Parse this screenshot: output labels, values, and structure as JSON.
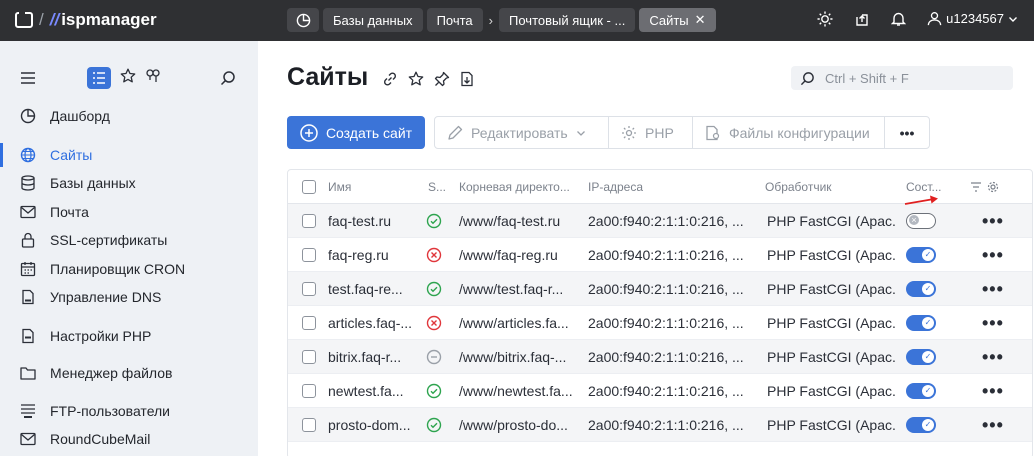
{
  "topbar": {
    "logo_text": "ispmanager",
    "breadcrumbs": [
      "Базы данных",
      "Почта",
      "Почтовый ящик - ...",
      "Сайты"
    ],
    "close_symbol": "✕",
    "username": "u1234567"
  },
  "sidebar": {
    "items": [
      {
        "label": "Дашборд",
        "icon": "dashboard-icon"
      },
      {
        "label": "Сайты",
        "icon": "globe-icon",
        "active": true
      },
      {
        "label": "Базы данных",
        "icon": "database-icon"
      },
      {
        "label": "Почта",
        "icon": "mail-icon"
      },
      {
        "label": "SSL-сертификаты",
        "icon": "lock-icon"
      },
      {
        "label": "Планировщик CRON",
        "icon": "calendar-icon"
      },
      {
        "label": "Управление DNS",
        "icon": "dns-icon"
      },
      {
        "label": "Настройки PHP",
        "icon": "php-icon"
      },
      {
        "label": "Менеджер файлов",
        "icon": "folder-icon"
      },
      {
        "label": "FTP-пользователи",
        "icon": "ftp-icon"
      },
      {
        "label": "RoundCubeMail",
        "icon": "mail-icon"
      }
    ]
  },
  "main": {
    "title": "Сайты",
    "search_placeholder": "Ctrl + Shift + F",
    "toolbar": {
      "create": "Создать сайт",
      "edit": "Редактировать",
      "php": "PHP",
      "configs": "Файлы конфигурации",
      "more": "•••"
    },
    "table": {
      "headers": {
        "name": "Имя",
        "ssl": "S...",
        "root": "Корневая директо...",
        "ip": "IP-адреса",
        "handler": "Обработчик",
        "state": "Сост..."
      },
      "rows": [
        {
          "name": "faq-test.ru",
          "ssl": "ok",
          "root": "/www/faq-test.ru",
          "ip": "2a00:f940:2:1:1:0:216, ...",
          "handler": "PHP FastCGI (Apac...",
          "enabled": false
        },
        {
          "name": "faq-reg.ru",
          "ssl": "error",
          "root": "/www/faq-reg.ru",
          "ip": "2a00:f940:2:1:1:0:216, ...",
          "handler": "PHP FastCGI (Apac...",
          "enabled": true
        },
        {
          "name": "test.faq-re...",
          "ssl": "ok",
          "root": "/www/test.faq-r...",
          "ip": "2a00:f940:2:1:1:0:216, ...",
          "handler": "PHP FastCGI (Apac...",
          "enabled": true
        },
        {
          "name": "articles.faq-...",
          "ssl": "error",
          "root": "/www/articles.fa...",
          "ip": "2a00:f940:2:1:1:0:216, ...",
          "handler": "PHP FastCGI (Apac...",
          "enabled": true
        },
        {
          "name": "bitrix.faq-r...",
          "ssl": "none",
          "root": "/www/bitrix.faq-...",
          "ip": "2a00:f940:2:1:1:0:216, ...",
          "handler": "PHP FastCGI (Apac...",
          "enabled": true
        },
        {
          "name": "newtest.fa...",
          "ssl": "ok",
          "root": "/www/newtest.fa...",
          "ip": "2a00:f940:2:1:1:0:216, ...",
          "handler": "PHP FastCGI (Apac...",
          "enabled": true
        },
        {
          "name": "prosto-dom...",
          "ssl": "ok",
          "root": "/www/prosto-do...",
          "ip": "2a00:f940:2:1:1:0:216, ...",
          "handler": "PHP FastCGI (Apac...",
          "enabled": true
        }
      ],
      "row_menu": "•••"
    }
  },
  "colors": {
    "accent": "#3b74d8",
    "ok": "#2ea44f",
    "error": "#e0363b",
    "arrow": "#e02020"
  }
}
